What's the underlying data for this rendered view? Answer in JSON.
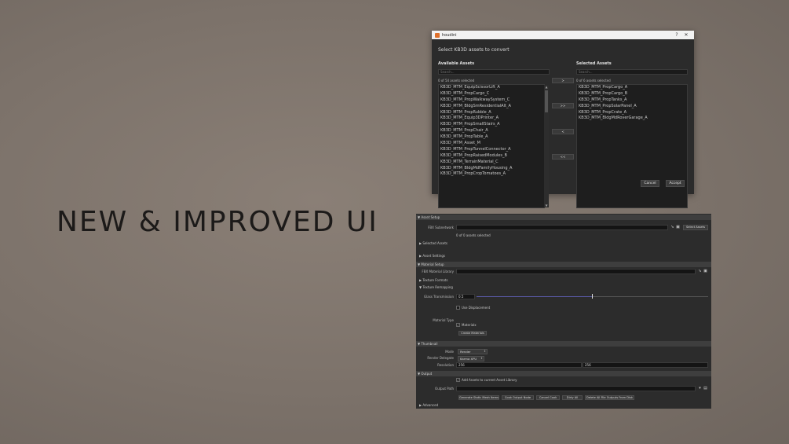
{
  "headline": "NEW & IMPROVED UI",
  "dialog": {
    "app_title": "houdini",
    "help": "?",
    "close": "✕",
    "heading": "Select KB3D assets to convert",
    "available": {
      "label": "Available Assets",
      "search_placeholder": "Search...",
      "count": "0 of 54 assets selected",
      "items": [
        "KB3D_MTM_EquipScissorLift_A",
        "KB3D_MTM_PropCargo_C",
        "KB3D_MTM_PropWalkwaySystem_C",
        "KB3D_MTM_BldgSmResidentialAlt_A",
        "KB3D_MTM_PropRubble_A",
        "KB3D_MTM_Equip3DPrinter_A",
        "KB3D_MTM_PropSmallStairs_A",
        "KB3D_MTM_PropChair_A",
        "KB3D_MTM_PropTable_A",
        "KB3D_MTM_Asset_M",
        "KB3D_MTM_PropTunnelConnector_A",
        "KB3D_MTM_PropRaisedModules_B",
        "KB3D_MTM_TerrainMaterial_C",
        "KB3D_MTM_BldgMdFamilyHousing_A",
        "KB3D_MTM_PropCropTomatoes_A"
      ]
    },
    "selected": {
      "label": "Selected Assets",
      "search_placeholder": "Search...",
      "count": "0 of 6 assets selected",
      "items": [
        "KB3D_MTM_PropCargo_A",
        "KB3D_MTM_PropCargo_B",
        "KB3D_MTM_PropTanks_A",
        "KB3D_MTM_PropSolarPanel_A",
        "KB3D_MTM_PropCrate_A",
        "KB3D_MTM_BldgMdRoverGarage_A"
      ]
    },
    "move_buttons": [
      ">",
      ">>",
      "<",
      "<<"
    ],
    "cancel": "Cancel",
    "accept": "Accept"
  },
  "panel": {
    "asset_setup": "Asset Setup",
    "fbx_subnetwork_label": "FBX Subnetwork",
    "select_assets": "Select Assets",
    "assets_selected": "0 of 0 assets selected",
    "selected_assets": "Selected Assets",
    "asset_settings": "Asset Settings",
    "material_setup": "Material Setup",
    "fbx_material_library_label": "FBX Material Library",
    "texture_formats": "Texture Formats",
    "texture_remapping": "Texture Remapping",
    "glass_transmission_label": "Glass Transmission",
    "glass_transmission_value": "0.5",
    "glass_transmission_fraction": 0.5,
    "use_displacement": "Use Displacement",
    "material_type_label": "Material Type",
    "materialx": "Materialx",
    "create_materials": "Create Materials",
    "thumbnail": "Thumbnail",
    "mode_label": "Mode",
    "mode_value": "Render",
    "render_delegate_label": "Render Delegate",
    "render_delegate_value": "Karma XPU",
    "resolution_label": "Resolution",
    "res_x": "256",
    "res_y": "256",
    "output": "Output",
    "add_assets": "Add Assets to current Asset Library",
    "output_path_label": "Output Path",
    "buttons": [
      "Generate Static Mesh Items",
      "Cook Output Node",
      "Cancel Cook",
      "Dirty All",
      "Delete All File Outputs From Disk"
    ],
    "advanced": "Advanced"
  }
}
